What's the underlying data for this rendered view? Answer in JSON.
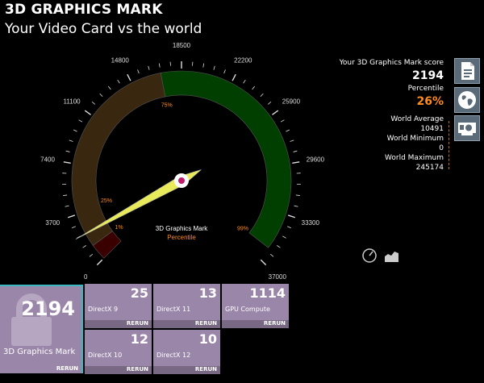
{
  "header": {
    "title": "3D GRAPHICS MARK",
    "subtitle": "Your Video Card vs the world"
  },
  "gauge": {
    "min": 0,
    "max": 37000,
    "tick_labels": [
      "0",
      "3700",
      "7400",
      "11100",
      "14800",
      "18500",
      "22200",
      "25900",
      "29600",
      "33300",
      "37000"
    ],
    "value": 2194,
    "caption": "3D Graphics Mark",
    "caption_sub": "Percentile",
    "percent_labels": [
      "1%",
      "25%",
      "75%",
      "99%"
    ],
    "colors": {
      "dark_red": "#3a0000",
      "brown": "#3a2710",
      "green": "#003f00",
      "needle": "#e8ea5a",
      "orange": "#ff8c1a"
    }
  },
  "stats": {
    "score_label": "Your 3D Graphics Mark score",
    "score": "2194",
    "percentile_label": "Percentile",
    "percentile": "26%",
    "world_average_label": "World Average",
    "world_average": "10491",
    "world_minimum_label": "World Minimum",
    "world_minimum": "0",
    "world_maximum_label": "World Maximum",
    "world_maximum": "245174"
  },
  "side_buttons": [
    "document-icon",
    "globe-icon",
    "graphics-card-icon"
  ],
  "tiles": {
    "main": {
      "value": "2194",
      "label": "3D Graphics Mark",
      "rerun": "RERUN"
    },
    "directx9": {
      "value": "25",
      "label": "DirectX 9",
      "rerun": "RERUN"
    },
    "directx11": {
      "value": "13",
      "label": "DirectX 11",
      "rerun": "RERUN"
    },
    "gpu_compute": {
      "value": "1114",
      "label": "GPU Compute",
      "rerun": "RERUN"
    },
    "directx10": {
      "value": "12",
      "label": "DirectX 10",
      "rerun": "RERUN"
    },
    "directx12": {
      "value": "10",
      "label": "DirectX 12",
      "rerun": "RERUN"
    }
  }
}
